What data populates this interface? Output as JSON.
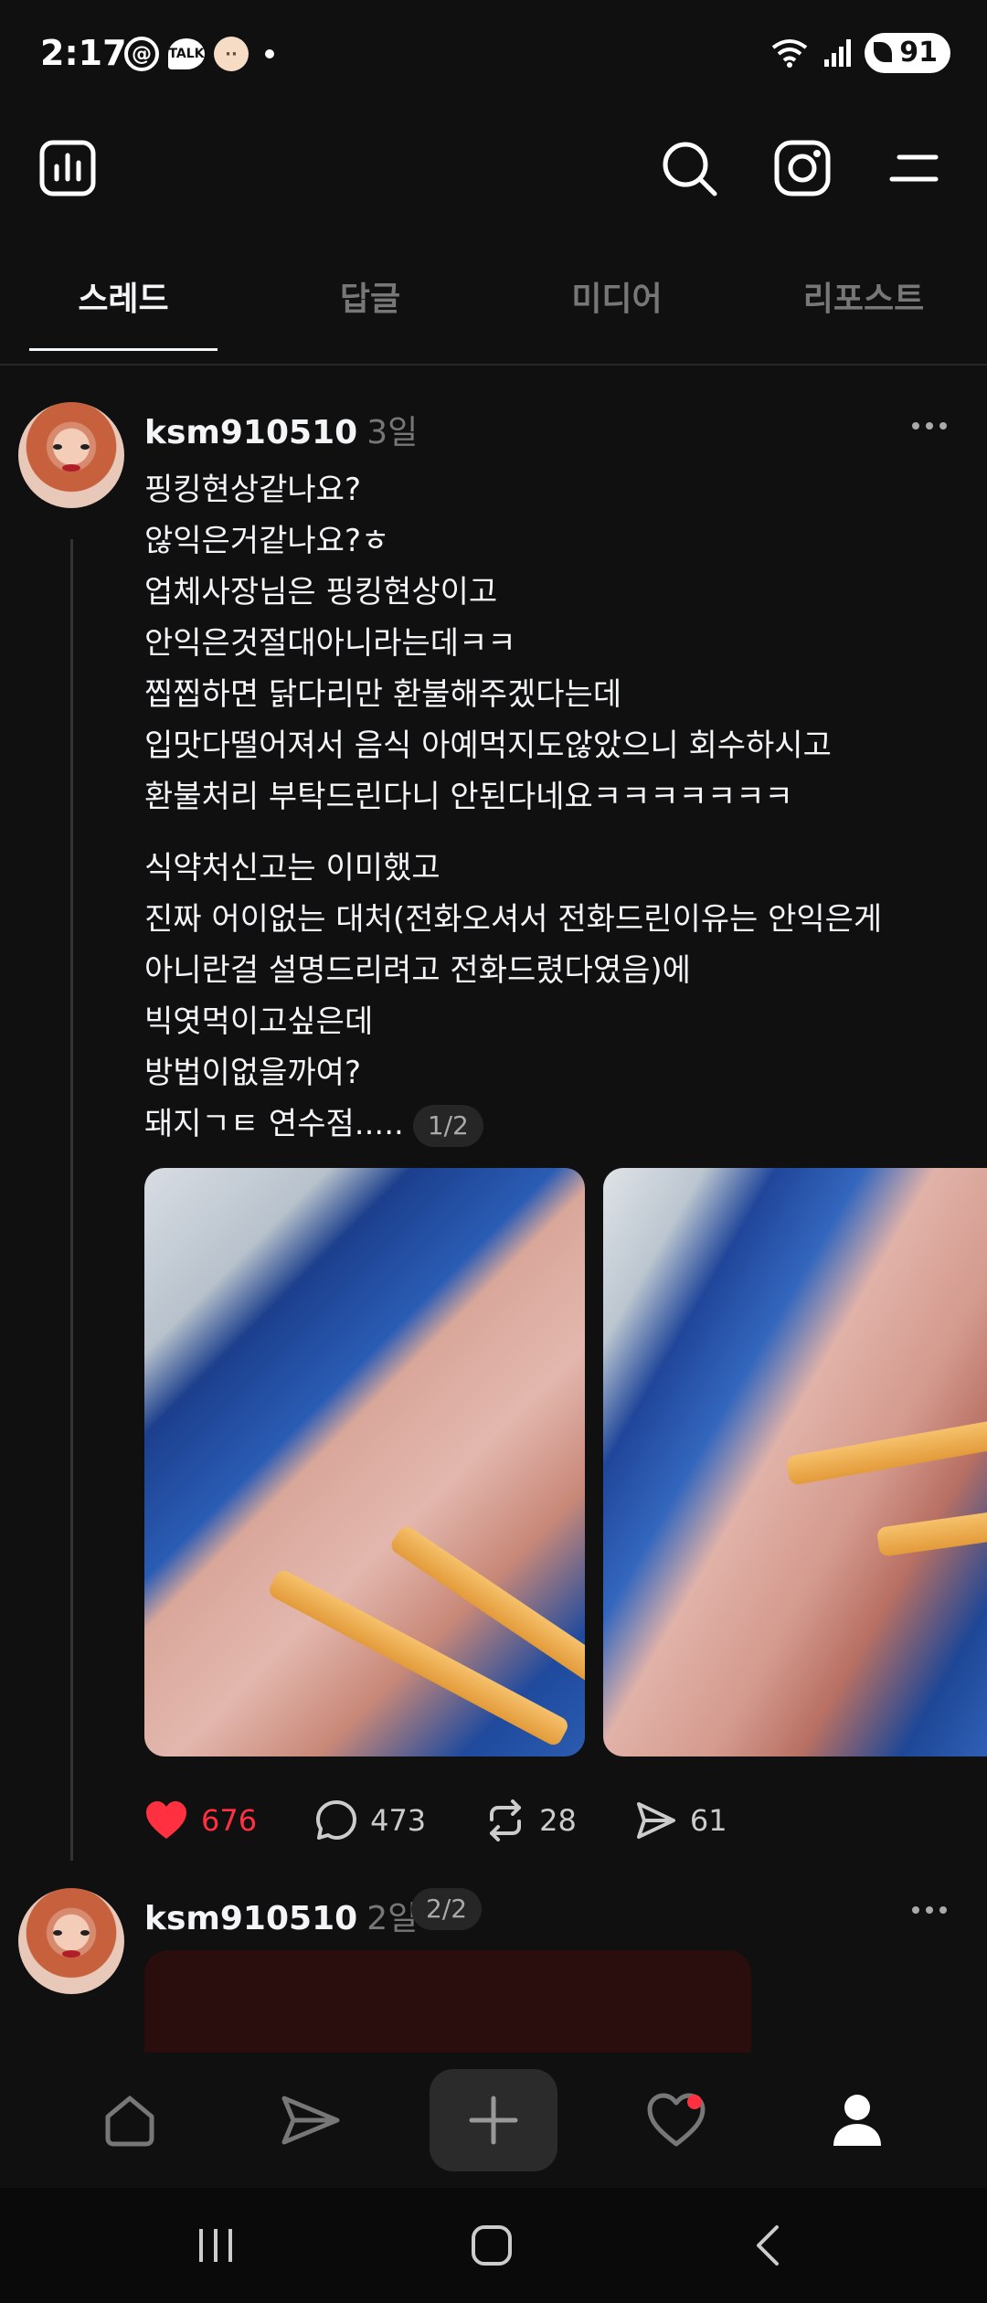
{
  "status_bar": {
    "time": "2:17",
    "talk_label": "TALK",
    "battery": "91"
  },
  "tabs": [
    {
      "label": "스레드",
      "active": true
    },
    {
      "label": "답글",
      "active": false
    },
    {
      "label": "미디어",
      "active": false
    },
    {
      "label": "리포스트",
      "active": false
    }
  ],
  "post": {
    "username": "ksm910510",
    "age": "3일",
    "paragraph1": [
      "핑킹현상같나요?",
      "않익은거같나요?ㅎ",
      "업체사장님은 핑킹현상이고",
      "안익은것절대아니라는데ㅋㅋ",
      "찝찝하면 닭다리만 환불해주겠다는데",
      "입맛다떨어져서 음식 아예먹지도않았으니 회수하시고",
      "환불처리 부탁드린다니 안된다네요ㅋㅋㅋㅋㅋㅋㅋ"
    ],
    "paragraph2": [
      "식약처신고는 이미했고",
      "진짜 어이없는 대처(전화오셔서 전화드린이유는 안익은게",
      "아니란걸 설명드리려고 전화드렸다였음)에",
      "빅엿먹이고싶은데",
      "방법이없을까여?"
    ],
    "last_line": "돼지ㄱㅌ 연수점.....",
    "counter": "1/2",
    "likes": "676",
    "comments": "473",
    "reposts": "28",
    "shares": "61"
  },
  "post2": {
    "username": "ksm910510",
    "age": "2일",
    "counter": "2/2"
  },
  "colors": {
    "background": "#101010",
    "like_red": "#ff3040",
    "muted": "#777777"
  }
}
